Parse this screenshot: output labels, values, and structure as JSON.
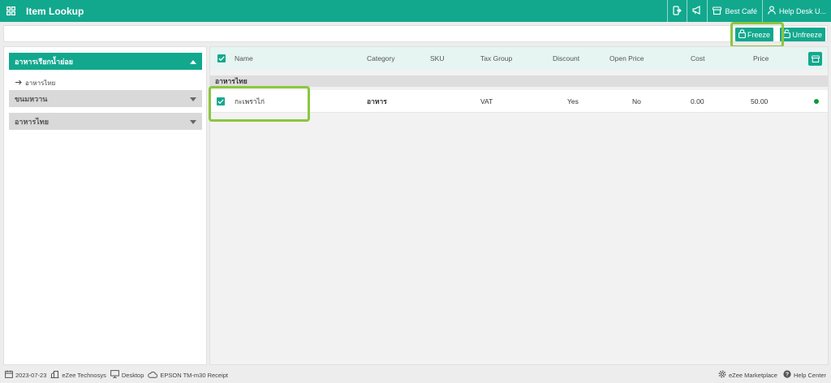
{
  "app": {
    "title": "Item Lookup"
  },
  "topbar": {
    "store_label": "Best Café",
    "user_label": "Help Desk U..."
  },
  "toolbar": {
    "search_placeholder": "",
    "freeze_label": "Freeze",
    "unfreeze_label": "Unfreeze"
  },
  "sidebar": {
    "groups": [
      {
        "label": "อาหารเรียกน้ำย่อย",
        "state": "expanded"
      },
      {
        "label": "ขนมหวาน",
        "state": "collapsed"
      },
      {
        "label": "อาหารไทย",
        "state": "collapsed"
      }
    ],
    "subitem": "อาหารไทย"
  },
  "table": {
    "columns": [
      "Name",
      "Category",
      "SKU",
      "Tax Group",
      "Discount",
      "Open Price",
      "Cost",
      "Price"
    ],
    "group_label": "อาหารไทย",
    "rows": [
      {
        "name": "กะเพราไก่",
        "category": "อาหาร",
        "sku": "",
        "tax_group": "VAT",
        "discount": "Yes",
        "open_price": "No",
        "cost": "0.00",
        "price": "50.00",
        "checked": true,
        "status_color": "#0a9a3c"
      }
    ]
  },
  "footer": {
    "date": "2023-07-23",
    "company": "eZee Technosys",
    "device": "Desktop",
    "printer": "EPSON TM-m30 Receipt",
    "marketplace": "eZee Marketplace",
    "help": "Help Center"
  },
  "colors": {
    "accent": "#12a88e",
    "highlight": "#8cc63f",
    "status_active": "#0a9a3c"
  }
}
